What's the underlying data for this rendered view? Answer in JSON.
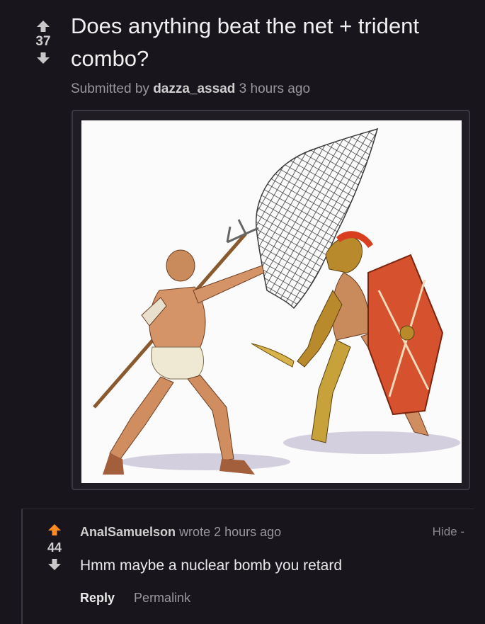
{
  "post": {
    "title": "Does anything beat the net + trident combo?",
    "score": "37",
    "submitted_prefix": "Submitted by",
    "author": "dazza_assad",
    "time": "3 hours ago",
    "upvote_icon": "arrow-up-icon",
    "downvote_icon": "arrow-down-icon",
    "image_subject": "illustration of a retiarius with net and trident fighting a secutor with sword and shield"
  },
  "comment": {
    "score": "44",
    "author": "AnalSamuelson",
    "wrote_text": "wrote 2 hours ago",
    "hide_label": "Hide -",
    "body": "Hmm maybe a nuclear bomb you retard",
    "reply_label": "Reply",
    "permalink_label": "Permalink"
  },
  "colors": {
    "background": "#18151c",
    "upvote_active": "#ff8b24",
    "arrow_neutral": "#c8c8c8",
    "text": "#e6e6e6",
    "muted": "#9a979e"
  }
}
